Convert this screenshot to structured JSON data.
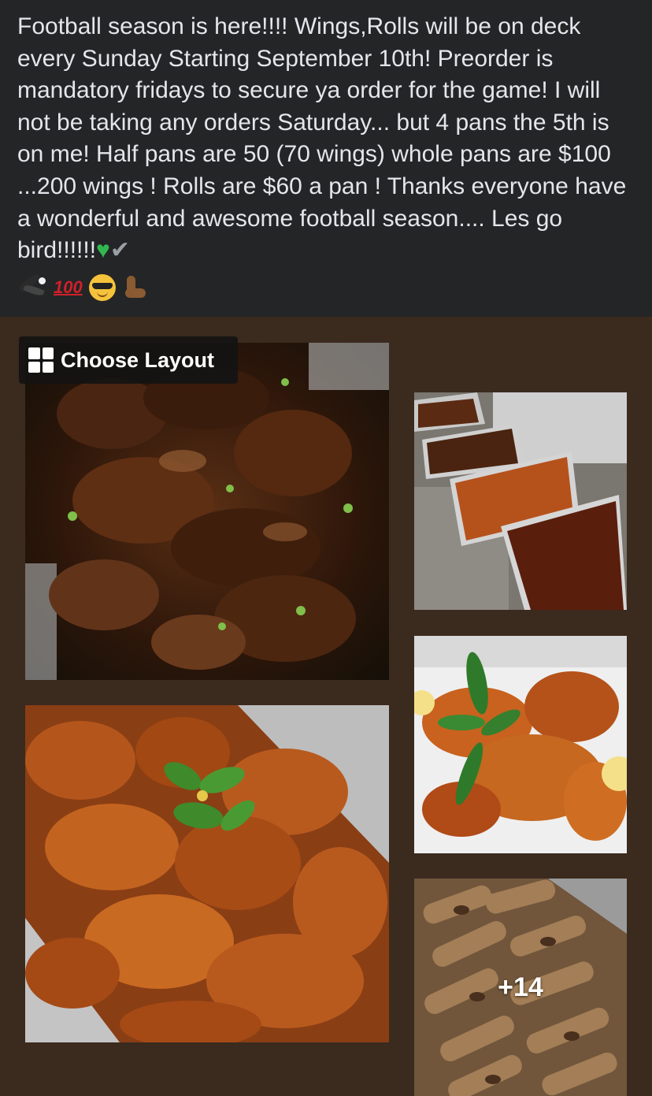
{
  "post": {
    "text": "Football season is here!!!! Wings,Rolls will be on deck every Sunday Starting September 10th! Preorder is mandatory fridays to secure ya order for the game! I will not be taking any orders Saturday... but 4 pans the 5th is on me! Half pans are 50 (70 wings) whole pans are $100 ...200 wings ! Rolls are $60 a pan ! Thanks everyone have a wonderful and awesome football season.... Les go bird!!!!!!",
    "hundred": "100",
    "icons": [
      "green-heart-icon",
      "check-mark-icon",
      "eagle-icon",
      "hundred-points-icon",
      "sunglasses-face-icon",
      "flexed-biceps-icon"
    ]
  },
  "layout_button": {
    "label": "Choose Layout",
    "icon": "grid-layout-icon"
  },
  "photos": {
    "more_count": "+14"
  },
  "colors": {
    "post_bg": "#242526",
    "text": "#e4e6eb",
    "photo_bg": "#3b2a1e",
    "heart": "#31b84f"
  }
}
